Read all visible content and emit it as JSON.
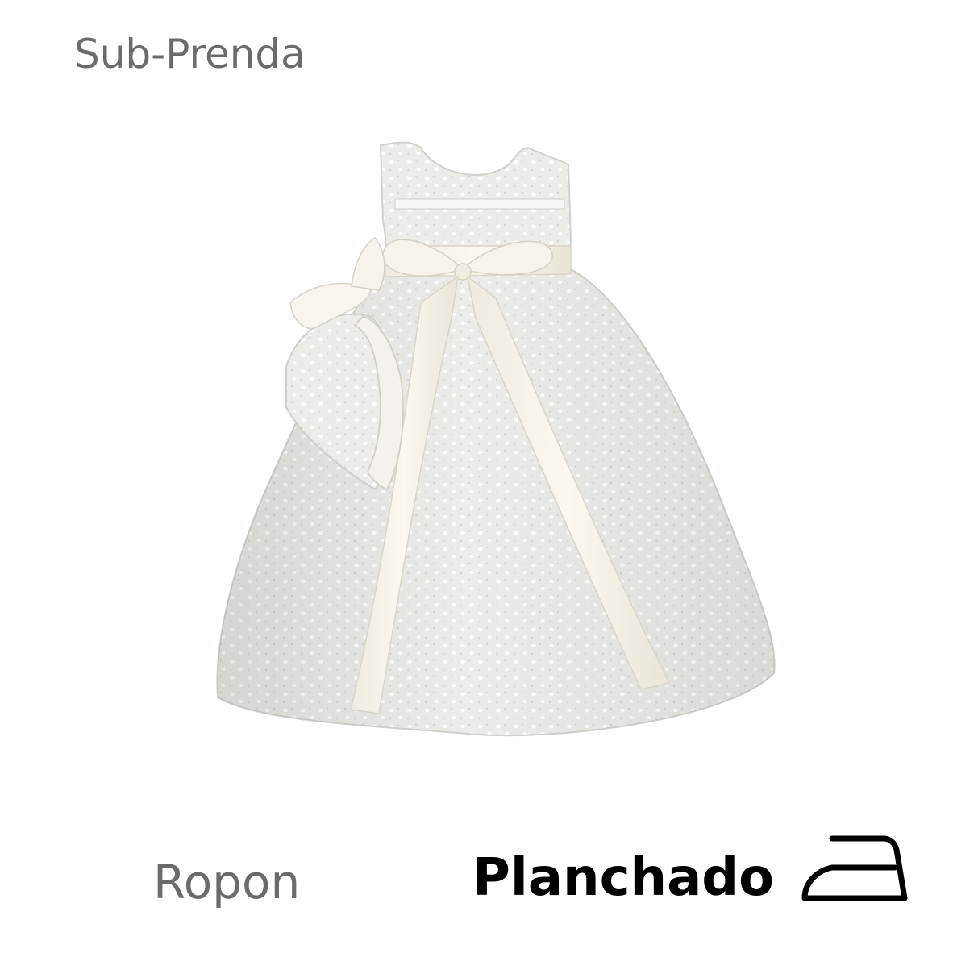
{
  "header": {
    "subtitle": "Sub-Prenda"
  },
  "product": {
    "name": "Ropon",
    "image_icon": "christening-gown-illustration"
  },
  "care": {
    "instruction": "Planchado",
    "icon": "iron-icon"
  },
  "colors": {
    "text_gray": "#6b6b6b",
    "text_black": "#000000",
    "fabric": "#f2f2ef",
    "ribbon": "#f7f5ec"
  }
}
